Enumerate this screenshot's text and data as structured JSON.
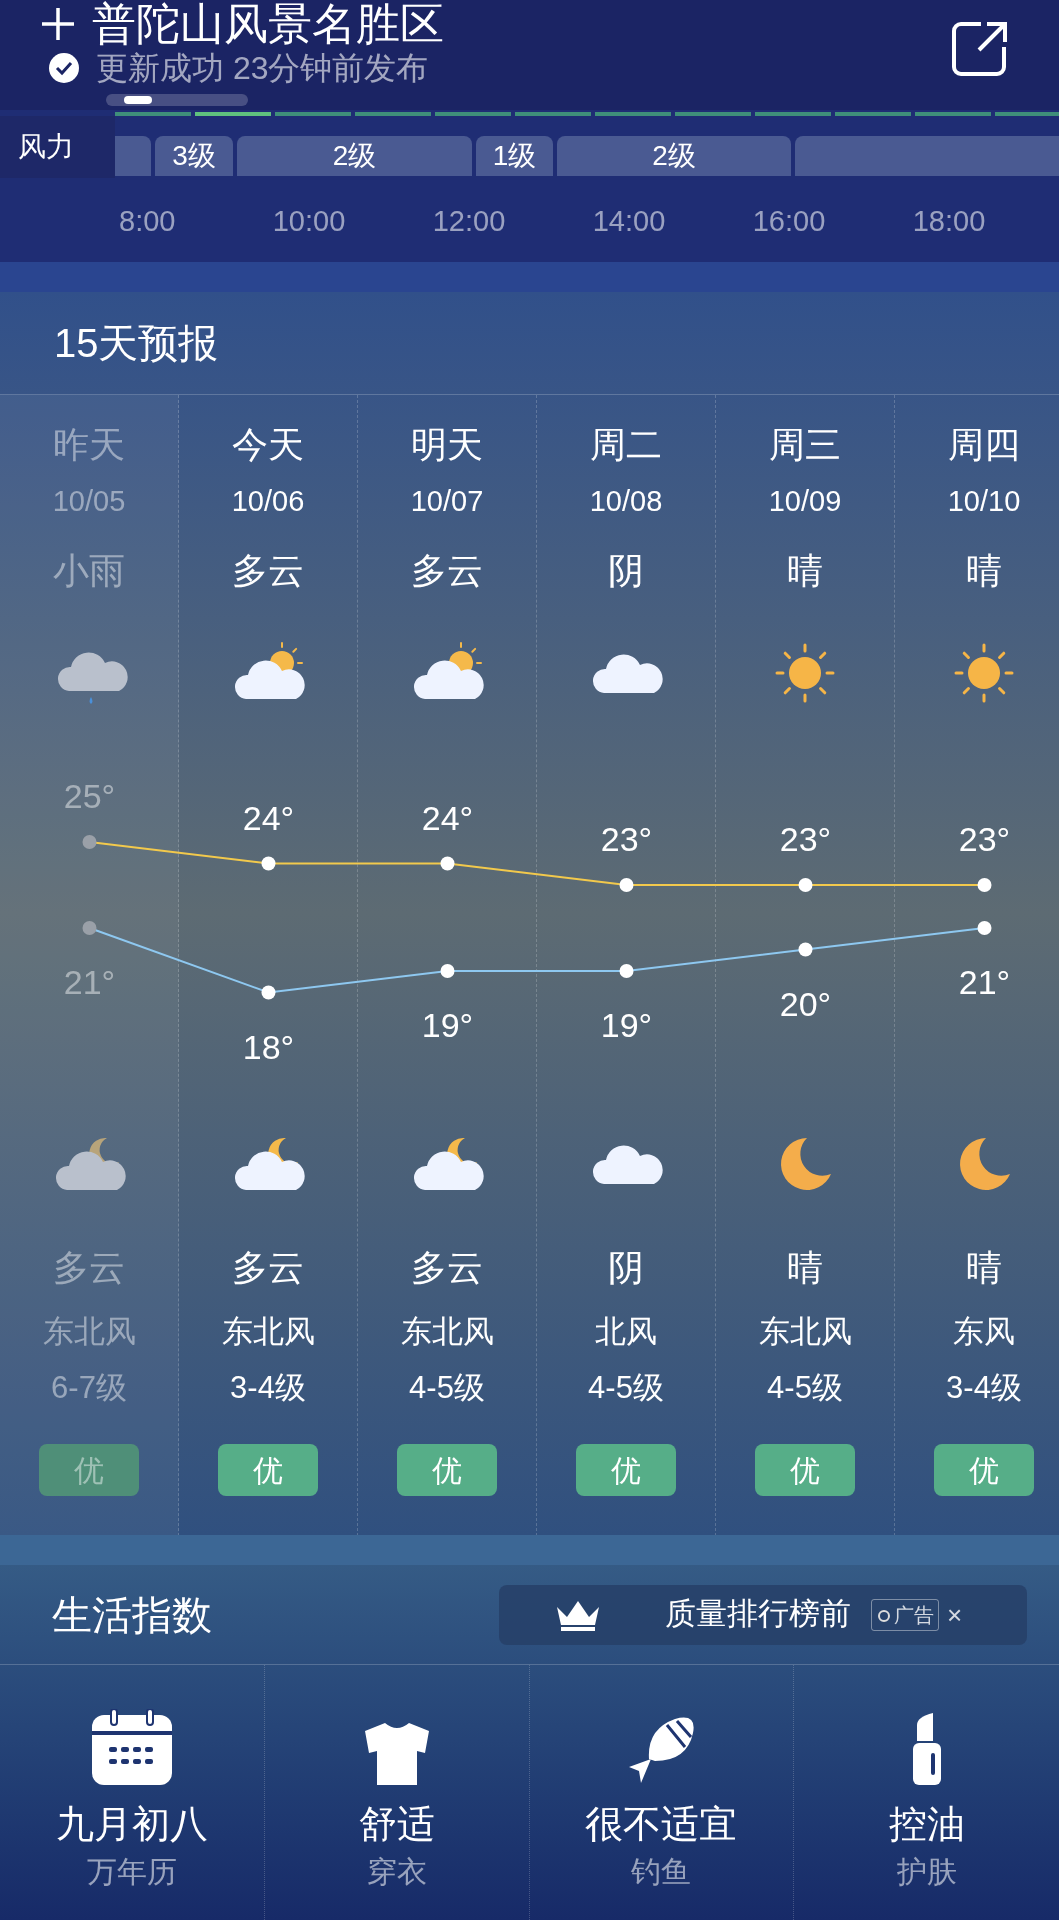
{
  "header": {
    "title": "普陀山风景名胜区",
    "status": "更新成功 23分钟前发布"
  },
  "hourly": {
    "label": "风力",
    "segments": [
      "3级",
      "2级",
      "1级",
      "2级"
    ],
    "times": [
      "8:00",
      "10:00",
      "12:00",
      "14:00",
      "16:00",
      "18:00"
    ]
  },
  "forecast": {
    "title": "15天预报",
    "days": [
      {
        "day": "昨天",
        "date": "10/05",
        "past": true,
        "daytime": {
          "kind": "rain",
          "weather": "小雨"
        },
        "high": "25°",
        "low": "21°",
        "night": {
          "kind": "partly_cloudy_night",
          "weather": "多云"
        },
        "wind_dir": "东北风",
        "wind_level": "6-7级",
        "aqi": "优"
      },
      {
        "day": "今天",
        "date": "10/06",
        "past": false,
        "daytime": {
          "kind": "partly_cloudy",
          "weather": "多云"
        },
        "high": "24°",
        "low": "18°",
        "night": {
          "kind": "partly_cloudy_night",
          "weather": "多云"
        },
        "wind_dir": "东北风",
        "wind_level": "3-4级",
        "aqi": "优"
      },
      {
        "day": "明天",
        "date": "10/07",
        "past": false,
        "daytime": {
          "kind": "partly_cloudy",
          "weather": "多云"
        },
        "high": "24°",
        "low": "19°",
        "night": {
          "kind": "partly_cloudy_night",
          "weather": "多云"
        },
        "wind_dir": "东北风",
        "wind_level": "4-5级",
        "aqi": "优"
      },
      {
        "day": "周二",
        "date": "10/08",
        "past": false,
        "daytime": {
          "kind": "cloudy",
          "weather": "阴"
        },
        "high": "23°",
        "low": "19°",
        "night": {
          "kind": "cloudy",
          "weather": "阴"
        },
        "wind_dir": "北风",
        "wind_level": "4-5级",
        "aqi": "优"
      },
      {
        "day": "周三",
        "date": "10/09",
        "past": false,
        "daytime": {
          "kind": "sunny",
          "weather": "晴"
        },
        "high": "23°",
        "low": "20°",
        "night": {
          "kind": "clear_night",
          "weather": "晴"
        },
        "wind_dir": "东北风",
        "wind_level": "4-5级",
        "aqi": "优"
      },
      {
        "day": "周四",
        "date": "10/10",
        "past": false,
        "daytime": {
          "kind": "sunny",
          "weather": "晴"
        },
        "high": "23°",
        "low": "21°",
        "night": {
          "kind": "clear_night",
          "weather": "晴"
        },
        "wind_dir": "东风",
        "wind_level": "3-4级",
        "aqi": "优"
      }
    ]
  },
  "life": {
    "title": "生活指数",
    "ad": {
      "text": "质量排行榜前",
      "tag": "广告",
      "close": "×"
    },
    "items": [
      {
        "kind": "calendar",
        "value": "九月初八",
        "label": "万年历"
      },
      {
        "kind": "shirt",
        "value": "舒适",
        "label": "穿衣"
      },
      {
        "kind": "fish",
        "value": "很不适宜",
        "label": "钓鱼"
      },
      {
        "kind": "lipstick",
        "value": "控油",
        "label": "护肤"
      }
    ]
  }
}
